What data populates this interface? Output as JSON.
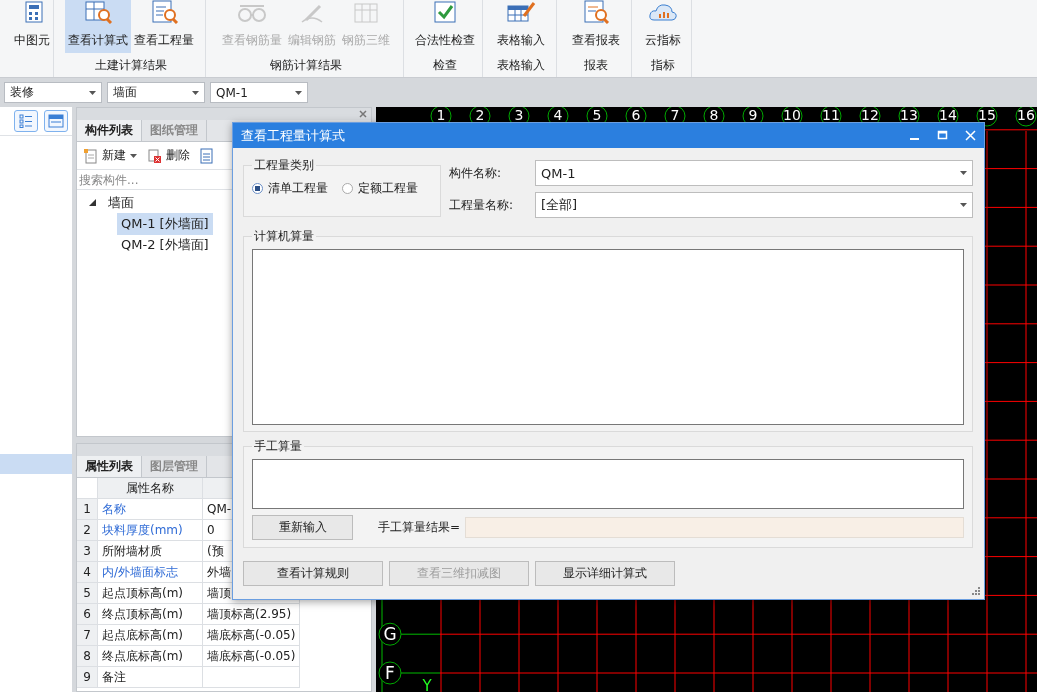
{
  "ribbon": {
    "groups": [
      {
        "buttons": [
          {
            "label": "中图元",
            "selected": false,
            "disabled": false
          }
        ]
      },
      {
        "label": "土建计算结果",
        "buttons": [
          {
            "label": "查看计算式",
            "selected": true,
            "disabled": false
          },
          {
            "label": "查看工程量",
            "selected": false,
            "disabled": false
          }
        ]
      },
      {
        "label": "钢筋计算结果",
        "buttons": [
          {
            "label": "查看钢筋量",
            "selected": false,
            "disabled": true
          },
          {
            "label": "编辑钢筋",
            "selected": false,
            "disabled": true
          },
          {
            "label": "钢筋三维",
            "selected": false,
            "disabled": true
          }
        ]
      },
      {
        "label": "检查",
        "buttons": [
          {
            "label": "合法性检查",
            "selected": false,
            "disabled": false
          }
        ]
      },
      {
        "label": "表格输入",
        "buttons": [
          {
            "label": "表格输入",
            "selected": false,
            "disabled": false
          }
        ]
      },
      {
        "label": "报表",
        "buttons": [
          {
            "label": "查看报表",
            "selected": false,
            "disabled": false
          }
        ]
      },
      {
        "label": "指标",
        "buttons": [
          {
            "label": "云指标",
            "selected": false,
            "disabled": false
          }
        ]
      }
    ]
  },
  "toolbar": {
    "combos": [
      "装修",
      "墙面",
      "QM-1"
    ]
  },
  "sidebar": {
    "row_selected": true
  },
  "component_panel": {
    "tabs": [
      {
        "label": "构件列表",
        "selected": true
      },
      {
        "label": "图纸管理",
        "selected": false
      }
    ],
    "actions": [
      {
        "label": "新建",
        "dropdown": true
      },
      {
        "label": "删除",
        "dropdown": false
      }
    ],
    "search": {
      "placeholder": "搜索构件..."
    },
    "tree": [
      {
        "label": "墙面",
        "expanded": true,
        "children": [
          {
            "label": "QM-1 [外墙面]",
            "selected": true
          },
          {
            "label": "QM-2 [外墙面]",
            "selected": false
          }
        ]
      }
    ]
  },
  "property_panel": {
    "tabs": [
      {
        "label": "属性列表",
        "selected": true
      },
      {
        "label": "图层管理",
        "selected": false
      }
    ],
    "columns": [
      "属性名称"
    ],
    "rows": [
      {
        "number": "1",
        "name": "名称",
        "value": "QM-",
        "emphasized": true
      },
      {
        "number": "2",
        "name": "块料厚度(mm)",
        "value": "0",
        "emphasized": true
      },
      {
        "number": "3",
        "name": "所附墙材质",
        "value": "(预",
        "emphasized": false
      },
      {
        "number": "4",
        "name": "内/外墙面标志",
        "value": "外墙",
        "emphasized": true
      },
      {
        "number": "5",
        "name": "起点顶标高(m)",
        "value": "墙顶",
        "emphasized": false
      },
      {
        "number": "6",
        "name": "终点顶标高(m)",
        "value": "墙顶标高(2.95)",
        "emphasized": false
      },
      {
        "number": "7",
        "name": "起点底标高(m)",
        "value": "墙底标高(-0.05)",
        "emphasized": false
      },
      {
        "number": "8",
        "name": "终点底标高(m)",
        "value": "墙底标高(-0.05)",
        "emphasized": false
      },
      {
        "number": "9",
        "name": "备注",
        "emphasized": false
      }
    ]
  },
  "canvas": {
    "column_axes": [
      "1",
      "2",
      "3",
      "4",
      "5",
      "6",
      "7",
      "8",
      "9",
      "10",
      "11",
      "12",
      "13",
      "14",
      "15",
      "16"
    ],
    "row_axes": [
      "G",
      "F"
    ],
    "ucs_label": "Y"
  },
  "dialog": {
    "title": "查看工程量计算式",
    "quantity_type": {
      "legend": "工程量类别",
      "options": [
        {
          "label": "清单工程量",
          "selected": true
        },
        {
          "label": "定额工程量",
          "selected": false
        }
      ]
    },
    "fields": [
      {
        "label": "构件名称:",
        "value": "QM-1"
      },
      {
        "label": "工程量名称:",
        "value": "[全部]"
      }
    ],
    "computer_section": {
      "legend": "计算机算量"
    },
    "manual_section": {
      "legend": "手工算量",
      "reset_button": "重新输入",
      "result_label": "手工算量结果="
    },
    "buttons": [
      {
        "label": "查看计算规则",
        "disabled": false
      },
      {
        "label": "查看三维扣减图",
        "disabled": true
      },
      {
        "label": "显示详细计算式",
        "disabled": false
      }
    ]
  }
}
